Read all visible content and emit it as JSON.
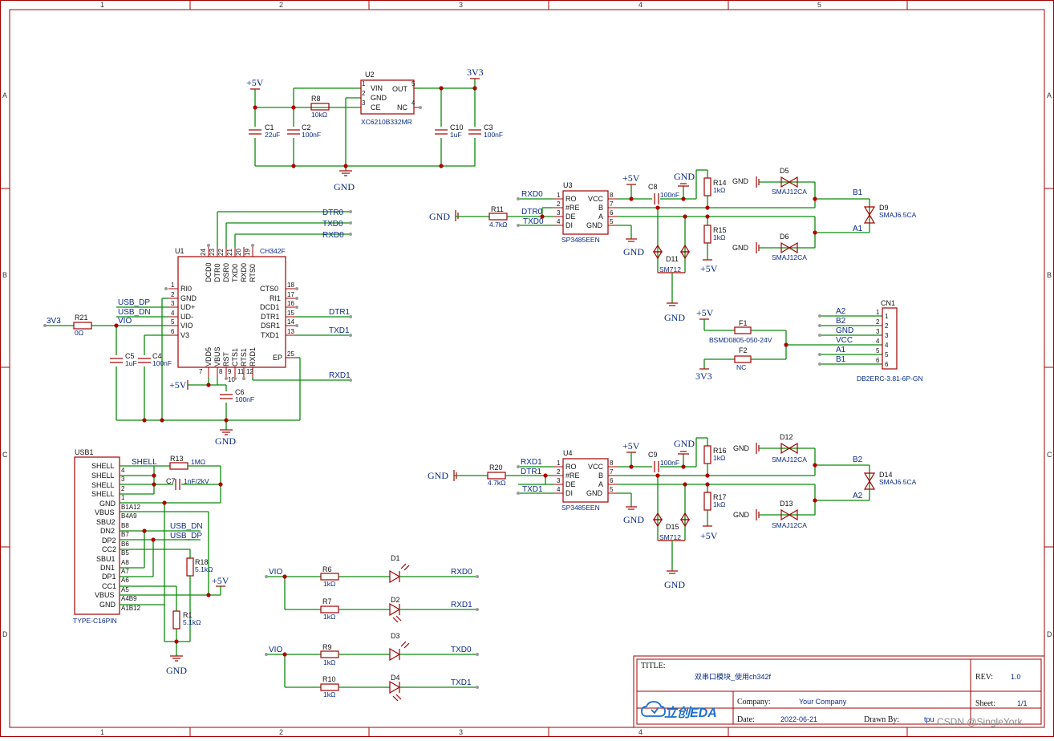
{
  "border": {
    "columns": [
      "1",
      "2",
      "3",
      "4",
      "5"
    ],
    "rows": [
      "A",
      "B",
      "C",
      "D"
    ]
  },
  "title_block": {
    "title_label": "TITLE:",
    "title_value": "双串口模块_使用ch342f",
    "rev_label": "REV:",
    "rev_value": "1.0",
    "company_label": "Company:",
    "company_value": "Your Company",
    "sheet_label": "Sheet:",
    "sheet_value": "1/1",
    "date_label": "Date:",
    "date_value": "2022-06-21",
    "drawn_label": "Drawn By:",
    "drawn_value": "tpu",
    "logo_text": "立创EDA",
    "watermark": "CSDN @SingleYork"
  },
  "power": {
    "p5v": "+5V",
    "p3v3": "3V3",
    "gnd": "GND",
    "vio": "VIO"
  },
  "u2": {
    "ref": "U2",
    "part": "XC6210B332MR",
    "pins": [
      "VIN",
      "GND",
      "CE",
      "OUT",
      "NC"
    ],
    "nums": [
      "1",
      "2",
      "3",
      "5",
      "4"
    ]
  },
  "ldo_parts": {
    "c1": "C1",
    "c1v": "22uF",
    "c2": "C2",
    "c2v": "100nF",
    "r8": "R8",
    "r8v": "10kΩ",
    "c10": "C10",
    "c10v": "1uF",
    "c3": "C3",
    "c3v": "100nF"
  },
  "u1": {
    "ref": "U1",
    "part": "CH342F",
    "left_pins": [
      "RI0",
      "GND",
      "UD+",
      "UD-",
      "VIO",
      "V3"
    ],
    "left_nums": [
      "1",
      "2",
      "3",
      "4",
      "5",
      "6"
    ],
    "right_pins": [
      "CTS0",
      "RI1",
      "DCD1",
      "DTR1",
      "DSR1",
      "TXD1",
      "EP"
    ],
    "right_nums": [
      "18",
      "17",
      "16",
      "15",
      "14",
      "13",
      "25"
    ],
    "top_pins": [
      "DCD0",
      "DTR0",
      "DSR0",
      "TXD0",
      "RXD0",
      "RTS0"
    ],
    "top_nums": [
      "24",
      "23",
      "22",
      "21",
      "20",
      "19"
    ],
    "bottom_pins": [
      "VDD5",
      "VBUS",
      "RST",
      "CTS1",
      "RTS1",
      "RXD1"
    ],
    "bottom_nums": [
      "7",
      "8",
      "9",
      "10",
      "11",
      "12"
    ]
  },
  "u1_parts": {
    "r21": "R21",
    "r21v": "0Ω",
    "c5": "C5",
    "c5v": "1uF",
    "c4": "C4",
    "c4v": "100nF",
    "c6": "C6",
    "c6v": "100nF"
  },
  "nets": {
    "usb_dp": "USB_DP",
    "usb_dn": "USB_DN",
    "dtr0": "DTR0",
    "txd0": "TXD0",
    "rxd0": "RXD0",
    "dtr1": "DTR1",
    "txd1": "TXD1",
    "rxd1": "RXD1",
    "shell": "SHELL",
    "a1": "A1",
    "b1": "B1",
    "a2": "A2",
    "b2": "B2"
  },
  "rs485_top": {
    "ref": "U3",
    "part": "SP3485EEN",
    "r11": "R11",
    "r11v": "4.7kΩ",
    "c8": "C8",
    "c8v": "100nF",
    "r14": "R14",
    "r14v": "1kΩ",
    "r15": "R15",
    "r15v": "1kΩ",
    "d11": "D11",
    "d11v": "SM712",
    "d5": "D5",
    "d5v": "SMAJ12CA",
    "d6": "D6",
    "d6v": "SMAJ12CA",
    "d9": "D9",
    "d9v": "SMAJ6.5CA"
  },
  "rs485_bottom": {
    "ref": "U4",
    "part": "SP3485EEN",
    "r20": "R20",
    "r20v": "4.7kΩ",
    "c9": "C9",
    "c9v": "100nF",
    "r16": "R16",
    "r16v": "1kΩ",
    "r17": "R17",
    "r17v": "1kΩ",
    "d15": "D15",
    "d15v": "SM712",
    "d12": "D12",
    "d12v": "SMAJ12CA",
    "d13": "D13",
    "d13v": "SMAJ12CA",
    "d14": "D14",
    "d14v": "SMAJ6.5CA"
  },
  "sp3485": {
    "left_pins": [
      "RO",
      "#RE",
      "DE",
      "DI"
    ],
    "left_nums": [
      "1",
      "2",
      "3",
      "4"
    ],
    "right_pins": [
      "VCC",
      "B",
      "A",
      "GND"
    ],
    "right_nums": [
      "8",
      "7",
      "6",
      "5"
    ]
  },
  "cn1": {
    "ref": "CN1",
    "part": "DB2ERC-3.81-6P-GN",
    "nets": [
      "A2",
      "B2",
      "GND",
      "VCC",
      "A1",
      "B1"
    ],
    "nums": [
      "1",
      "2",
      "3",
      "4",
      "5",
      "6"
    ],
    "f1": "F1",
    "f1v": "BSMD0805-050-24V",
    "f2": "F2",
    "f2v": "NC"
  },
  "usb1": {
    "ref": "USB1",
    "part": "TYPE-C16PIN",
    "pins": [
      "SHELL",
      "SHELL",
      "SHELL",
      "SHELL",
      "GND",
      "VBUS",
      "SBU2",
      "DN2",
      "DP2",
      "CC2",
      "SBU1",
      "DN1",
      "DP1",
      "CC1",
      "VBUS",
      "GND"
    ],
    "nums": [
      "4",
      "3",
      "2",
      "1",
      "B1A12",
      "B4A9",
      "B8",
      "B7",
      "B6",
      "B5",
      "A8",
      "A7",
      "A6",
      "A5",
      "A4B9",
      "A1B12"
    ],
    "r13": "R13",
    "r13v": "1MΩ",
    "c7": "C7",
    "c7v": "1nF/2kV",
    "r18": "R18",
    "r18v": "5.1kΩ",
    "r1": "R1",
    "r1v": "5.1kΩ"
  },
  "leds": [
    {
      "r": "R6",
      "rv": "1kΩ",
      "d": "D1",
      "net": "RXD0"
    },
    {
      "r": "R7",
      "rv": "1kΩ",
      "d": "D2",
      "net": "RXD1"
    },
    {
      "r": "R9",
      "rv": "1kΩ",
      "d": "D3",
      "net": "TXD0"
    },
    {
      "r": "R10",
      "rv": "1kΩ",
      "d": "D4",
      "net": "TXD1"
    }
  ]
}
